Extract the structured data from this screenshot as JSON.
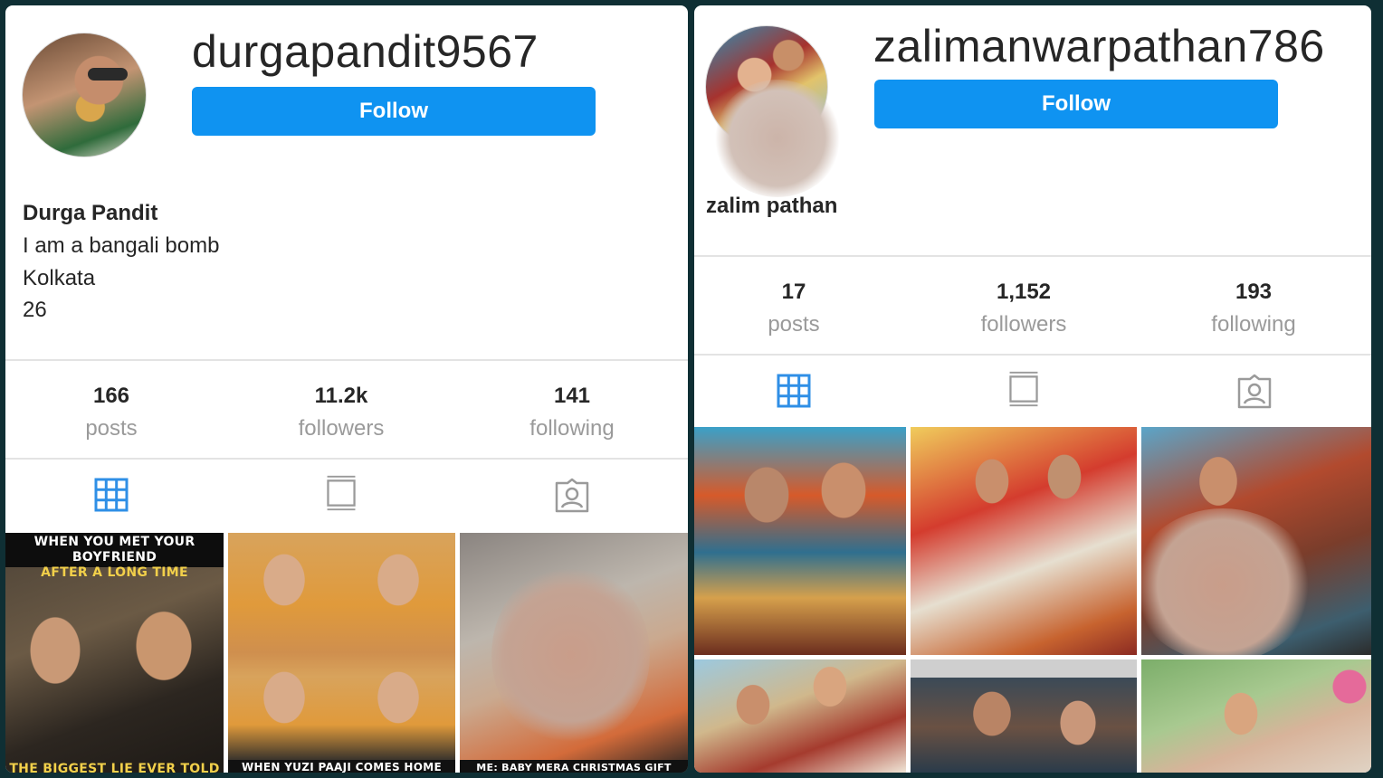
{
  "left_profile": {
    "username": "durgapandit9567",
    "follow_label": "Follow",
    "full_name": "Durga Pandit",
    "bio": [
      "I am a bangali bomb",
      "Kolkata",
      "26"
    ],
    "stats": [
      {
        "value": "166",
        "label": "posts"
      },
      {
        "value": "11.2k",
        "label": "followers"
      },
      {
        "value": "141",
        "label": "following"
      }
    ],
    "tabs": [
      "grid-icon",
      "feed-icon",
      "tagged-icon"
    ],
    "active_tab": "grid-icon",
    "posts": [
      {
        "caption_top": [
          "WHEN YOU MET YOUR BOYFRIEND",
          "AFTER A LONG TIME"
        ],
        "caption_bottom": "THE BIGGEST LIE EVER TOLD"
      },
      {
        "caption_top": [],
        "caption_bottom": "WHEN YUZI PAAJI COMES HOME WITH"
      },
      {
        "caption_top": [],
        "caption_bottom": "ME: BABY MERA CHRISTMAS GIFT KAHA HAI?"
      }
    ]
  },
  "right_profile": {
    "username": "zalimanwarpathan786",
    "follow_label": "Follow",
    "full_name": "zalim pathan",
    "stats": [
      {
        "value": "17",
        "label": "posts"
      },
      {
        "value": "1,152",
        "label": "followers"
      },
      {
        "value": "193",
        "label": "following"
      }
    ],
    "tabs": [
      "grid-icon",
      "feed-icon",
      "tagged-icon"
    ],
    "active_tab": "grid-icon"
  },
  "colors": {
    "accent": "#0f93f1",
    "active_tab": "#2f8fe6",
    "inactive_tab": "#9a9a9a",
    "background": "#0f2f34"
  }
}
